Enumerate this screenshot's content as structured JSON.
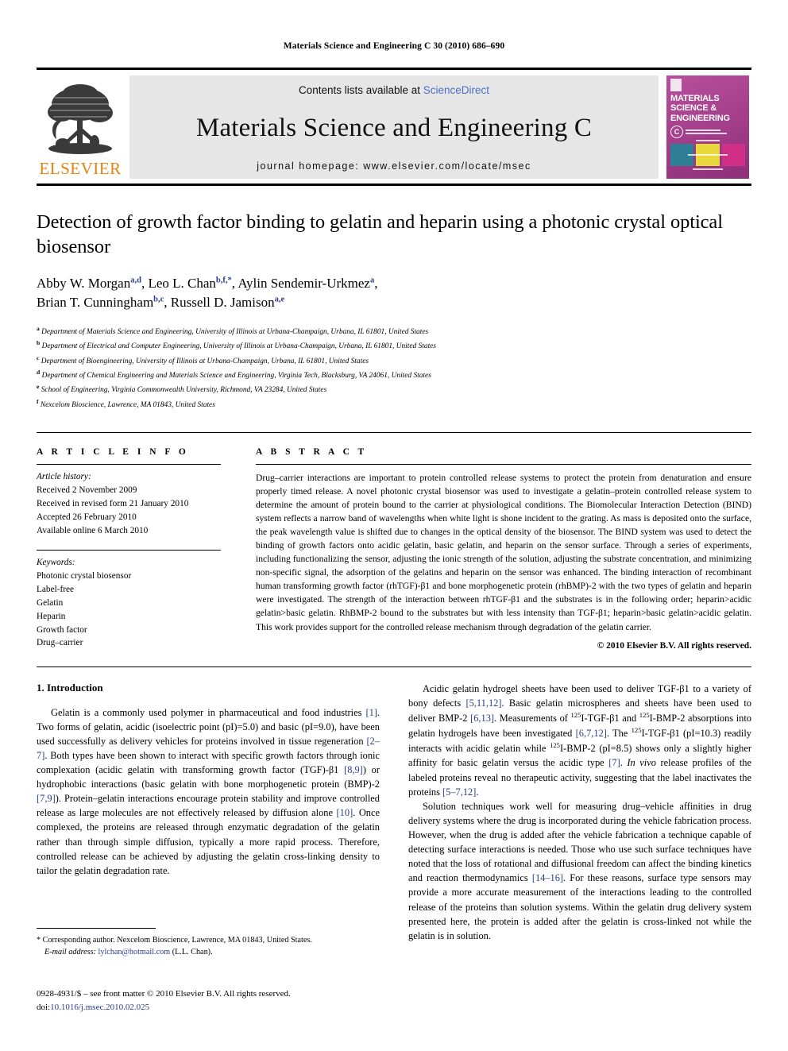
{
  "running_head": "Materials Science and Engineering C 30 (2010) 686–690",
  "banner": {
    "publisher_wordmark": "ELSEVIER",
    "contents_prefix": "Contents lists available at ",
    "contents_link": "ScienceDirect",
    "journal_title": "Materials Science and Engineering C",
    "homepage": "journal homepage: www.elsevier.com/locate/msec",
    "cover": {
      "title_line1": "MATERIALS",
      "title_line2": "SCIENCE &",
      "title_line3": "ENGINEERING",
      "badge_letter": "C"
    }
  },
  "article": {
    "title": "Detection of growth factor binding to gelatin and heparin using a photonic crystal optical biosensor",
    "authors": [
      {
        "name": "Abby W. Morgan",
        "marks": "a,d",
        "sep": ", "
      },
      {
        "name": "Leo L. Chan",
        "marks": "b,f,*",
        "sep": ", "
      },
      {
        "name": "Aylin Sendemir-Urkmez",
        "marks": "a",
        "sep": ","
      },
      {
        "name": "Brian T. Cunningham",
        "marks": "b,c",
        "sep": ", "
      },
      {
        "name": "Russell D. Jamison",
        "marks": "a,e",
        "sep": ""
      }
    ],
    "affiliations": [
      {
        "mark": "a",
        "text": "Department of Materials Science and Engineering, University of Illinois at Urbana-Champaign, Urbana, IL 61801, United States"
      },
      {
        "mark": "b",
        "text": "Department of Electrical and Computer Engineering, University of Illinois at Urbana-Champaign, Urbana, IL 61801, United States"
      },
      {
        "mark": "c",
        "text": "Department of Bioengineering, University of Illinois at Urbana-Champaign, Urbana, IL 61801, United States"
      },
      {
        "mark": "d",
        "text": "Department of Chemical Engineering and Materials Science and Engineering, Virginia Tech, Blacksburg, VA 24061, United States"
      },
      {
        "mark": "e",
        "text": "School of Engineering, Virginia Commonwealth University, Richmond, VA 23284, United States"
      },
      {
        "mark": "f",
        "text": "Nexcelom Bioscience, Lawrence, MA 01843, United States"
      }
    ]
  },
  "article_info": {
    "heading": "A R T I C L E   I N F O",
    "history_label": "Article history:",
    "history": [
      "Received 2 November 2009",
      "Received in revised form 21 January 2010",
      "Accepted 26 February 2010",
      "Available online 6 March 2010"
    ],
    "keywords_label": "Keywords:",
    "keywords": [
      "Photonic crystal biosensor",
      "Label-free",
      "Gelatin",
      "Heparin",
      "Growth factor",
      "Drug–carrier"
    ]
  },
  "abstract": {
    "heading": "A B S T R A C T",
    "text": "Drug–carrier interactions are important to protein controlled release systems to protect the protein from denaturation and ensure properly timed release. A novel photonic crystal biosensor was used to investigate a gelatin–protein controlled release system to determine the amount of protein bound to the carrier at physiological conditions. The Biomolecular Interaction Detection (BIND) system reflects a narrow band of wavelengths when white light is shone incident to the grating. As mass is deposited onto the surface, the peak wavelength value is shifted due to changes in the optical density of the biosensor. The BIND system was used to detect the binding of growth factors onto acidic gelatin, basic gelatin, and heparin on the sensor surface. Through a series of experiments, including functionalizing the sensor, adjusting the ionic strength of the solution, adjusting the substrate concentration, and minimizing non-specific signal, the adsorption of the gelatins and heparin on the sensor was enhanced. The binding interaction of recombinant human transforming growth factor (rhTGF)-β1 and bone morphogenetic protein (rhBMP)-2 with the two types of gelatin and heparin were investigated. The strength of the interaction between rhTGF-β1 and the substrates is in the following order; heparin>acidic gelatin>basic gelatin. RhBMP-2 bound to the substrates but with less intensity than TGF-β1; heparin>basic gelatin>acidic gelatin. This work provides support for the controlled release mechanism through degradation of the gelatin carrier.",
    "copyright": "© 2010 Elsevier B.V. All rights reserved."
  },
  "introduction": {
    "heading": "1. Introduction",
    "left_paragraph": "Gelatin is a commonly used polymer in pharmaceutical and food industries [1]. Two forms of gelatin, acidic (isoelectric point (pI)=5.0) and basic (pI=9.0), have been used successfully as delivery vehicles for proteins involved in tissue regeneration [2–7]. Both types have been shown to interact with specific growth factors through ionic complexation (acidic gelatin with transforming growth factor (TGF)-β1 [8,9]) or hydrophobic interactions (basic gelatin with bone morphogenetic protein (BMP)-2 [7,9]). Protein–gelatin interactions encourage protein stability and improve controlled release as large molecules are not effectively released by diffusion alone [10]. Once complexed, the proteins are released through enzymatic degradation of the gelatin rather than through simple diffusion, typically a more rapid process. Therefore, controlled release can be achieved by adjusting the gelatin cross-linking density to tailor the gelatin degradation rate.",
    "right_paragraph_1": "Acidic gelatin hydrogel sheets have been used to deliver TGF-β1 to a variety of bony defects [5,11,12]. Basic gelatin microspheres and sheets have been used to deliver BMP-2 [6,13]. Measurements of 125I-TGF-β1 and 125I-BMP-2 absorptions into gelatin hydrogels have been investigated [6,7,12]. The 125I-TGF-β1 (pI=10.3) readily interacts with acidic gelatin while 125I-BMP-2 (pI=8.5) shows only a slightly higher affinity for basic gelatin versus the acidic type [7]. In vivo release profiles of the labeled proteins reveal no therapeutic activity, suggesting that the label inactivates the proteins [5–7,12].",
    "right_paragraph_2": "Solution techniques work well for measuring drug–vehicle affinities in drug delivery systems where the drug is incorporated during the vehicle fabrication process. However, when the drug is added after the vehicle fabrication a technique capable of detecting surface interactions is needed. Those who use such surface techniques have noted that the loss of rotational and diffusional freedom can affect the binding kinetics and reaction thermodynamics [14–16]. For these reasons, surface type sensors may provide a more accurate measurement of the interactions leading to the controlled release of the proteins than solution systems. Within the gelatin drug delivery system presented here, the protein is added after the gelatin is cross-linked not while the gelatin is in solution."
  },
  "footnote": {
    "marker": "*",
    "text": "Corresponding author. Nexcelom Bioscience, Lawrence, MA 01843, United States.",
    "email_label": "E-mail address:",
    "email": "lylchan@hotmail.com",
    "email_suffix": "(L.L. Chan)."
  },
  "imprint": {
    "issn_line": "0928-4931/$ – see front matter © 2010 Elsevier B.V. All rights reserved.",
    "doi_label": "doi:",
    "doi": "10.1016/j.msec.2010.02.025"
  },
  "colors": {
    "link_blue": "#2b3b8f",
    "sciencedirect_blue": "#4b6fc4",
    "elsevier_orange": "#E8820C",
    "banner_gray": "#e6e6e6"
  }
}
